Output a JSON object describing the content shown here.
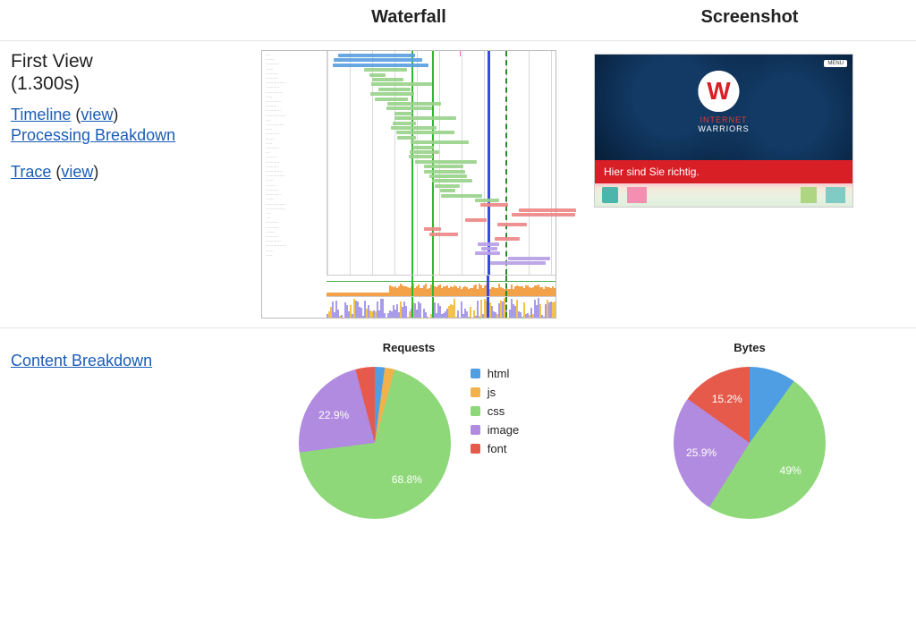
{
  "headers": {
    "waterfall": "Waterfall",
    "screenshot": "Screenshot"
  },
  "first_view": {
    "title": "First View",
    "timing": "(1.300s)",
    "timeline_link": "Timeline",
    "timeline_view": "view",
    "processing_link": "Processing Breakdown",
    "trace_link": "Trace",
    "trace_view": "view"
  },
  "content_breakdown_link": "Content Breakdown",
  "screenshot_thumb": {
    "brand_top": "INTERNET",
    "brand_bottom": "WARRIORS",
    "banner_text": "Hier sind Sie richtig.",
    "badge": "MENU"
  },
  "pies": {
    "requests": {
      "title": "Requests",
      "visible_labels": {
        "css": "68.8%",
        "image": "22.9%"
      }
    },
    "bytes": {
      "title": "Bytes",
      "visible_labels": {
        "css": "49%",
        "image": "25.9%",
        "font": "15.2%"
      }
    }
  },
  "legend": {
    "html": {
      "label": "html",
      "color": "#4f9ee3"
    },
    "js": {
      "label": "js",
      "color": "#f2b24b"
    },
    "css": {
      "label": "css",
      "color": "#8fd87a"
    },
    "image": {
      "label": "image",
      "color": "#b18be0"
    },
    "font": {
      "label": "font",
      "color": "#e55a4b"
    }
  },
  "chart_data": [
    {
      "type": "pie",
      "title": "Requests",
      "series": [
        {
          "name": "html",
          "value": 2.1,
          "color": "#4f9ee3"
        },
        {
          "name": "js",
          "value": 2.1,
          "color": "#f2b24b"
        },
        {
          "name": "css",
          "value": 68.8,
          "color": "#8fd87a"
        },
        {
          "name": "image",
          "value": 22.9,
          "color": "#b18be0"
        },
        {
          "name": "font",
          "value": 4.1,
          "color": "#e55a4b"
        }
      ],
      "labeled_slices": [
        "css",
        "image"
      ]
    },
    {
      "type": "pie",
      "title": "Bytes",
      "series": [
        {
          "name": "html",
          "value": 9.9,
          "color": "#4f9ee3"
        },
        {
          "name": "js",
          "value": 0.0,
          "color": "#f2b24b"
        },
        {
          "name": "css",
          "value": 49.0,
          "color": "#8fd87a"
        },
        {
          "name": "image",
          "value": 25.9,
          "color": "#b18be0"
        },
        {
          "name": "font",
          "value": 15.2,
          "color": "#e55a4b"
        }
      ],
      "labeled_slices": [
        "css",
        "image",
        "font"
      ]
    }
  ]
}
